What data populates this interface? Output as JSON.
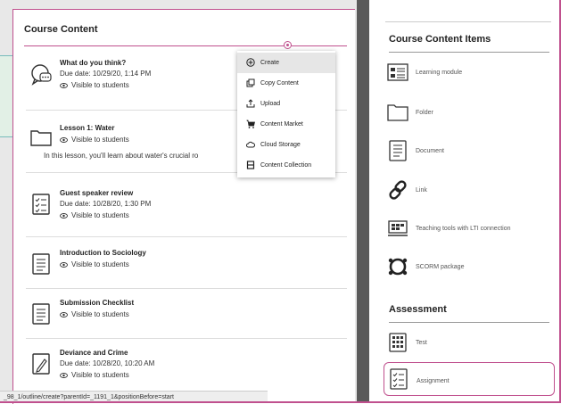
{
  "left_panel": {
    "title": "Course Content",
    "items": [
      {
        "name": "What do you think?",
        "due": "Due date: 10/29/20, 1:14 PM",
        "visibility": "Visible to students",
        "icon": "discussion-icon"
      },
      {
        "name": "Lesson 1: Water",
        "visibility": "Visible to students",
        "description": "In this lesson, you'll learn about water's crucial ro",
        "icon": "folder-icon"
      },
      {
        "name": "Guest speaker review",
        "due": "Due date: 10/28/20, 1:30 PM",
        "visibility": "Visible to students",
        "icon": "assignment-icon"
      },
      {
        "name": "Introduction to Sociology",
        "visibility": "Visible to students",
        "icon": "document-icon"
      },
      {
        "name": "Submission Checklist",
        "visibility": "Visible to students",
        "icon": "document-icon"
      },
      {
        "name": "Deviance and Crime",
        "due": "Due date: 10/28/20, 10:20 AM",
        "visibility": "Visible to students",
        "icon": "journal-icon"
      }
    ]
  },
  "menu": {
    "items": [
      {
        "label": "Create",
        "icon": "plus-circle-icon"
      },
      {
        "label": "Copy Content",
        "icon": "copy-icon"
      },
      {
        "label": "Upload",
        "icon": "upload-icon"
      },
      {
        "label": "Content Market",
        "icon": "cart-icon"
      },
      {
        "label": "Cloud Storage",
        "icon": "cloud-icon"
      },
      {
        "label": "Content Collection",
        "icon": "collection-icon"
      }
    ]
  },
  "status_bar": {
    "text": "_98_1/outline/create?parentId=_1191_1&positionBefore=start"
  },
  "right_panel": {
    "content_heading": "Course Content Items",
    "content_items": [
      {
        "label": "Learning module",
        "icon": "learning-module-icon"
      },
      {
        "label": "Folder",
        "icon": "folder-icon"
      },
      {
        "label": "Document",
        "icon": "document-icon"
      },
      {
        "label": "Link",
        "icon": "link-icon"
      },
      {
        "label": "Teaching tools with LTI connection",
        "icon": "lti-tools-icon"
      },
      {
        "label": "SCORM package",
        "icon": "scorm-icon"
      }
    ],
    "assessment_heading": "Assessment",
    "assessment_items": [
      {
        "label": "Test",
        "icon": "test-icon"
      },
      {
        "label": "Assignment",
        "icon": "assignment-icon"
      }
    ]
  },
  "colors": {
    "accent": "#c0508e",
    "divider": "#5a5a5a"
  }
}
